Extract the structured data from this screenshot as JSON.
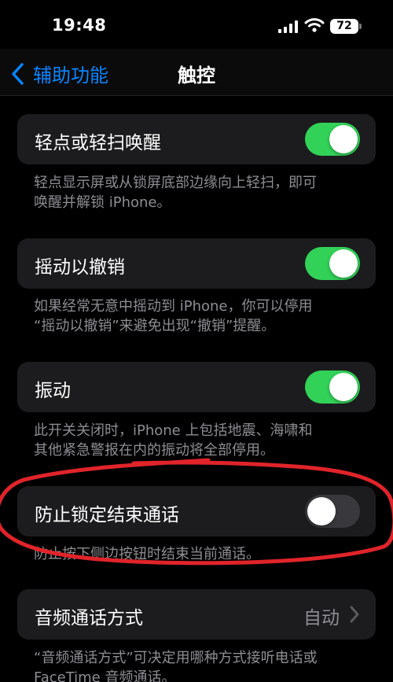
{
  "status": {
    "time": "19:48",
    "battery": "72",
    "icons": [
      "cellular-signal-icon",
      "wifi-icon",
      "battery-icon"
    ]
  },
  "nav": {
    "back_label": "辅助功能",
    "title": "触控"
  },
  "colors": {
    "accent": "#0a84ff",
    "toggle_on": "#32d158",
    "toggle_off": "#39393d",
    "annotation": "#e0242a"
  },
  "settings": [
    {
      "label": "轻点或轻扫唤醒",
      "toggle": true,
      "footer": [
        "轻点显示屏或从锁屏底部边缘向上轻扫，即可",
        "唤醒并解锁 iPhone。"
      ]
    },
    {
      "label": "摇动以撤销",
      "toggle": true,
      "footer": [
        "如果经常无意中摇动到 iPhone，你可以停用",
        "“摇动以撤销”来避免出现“撤销”提醒。"
      ]
    },
    {
      "label": "振动",
      "toggle": true,
      "footer": [
        "此开关关闭时，iPhone 上包括地震、海啸和",
        "其他紧急警报在内的振动将全部停用。"
      ]
    },
    {
      "label": "防止锁定结束通话",
      "toggle": false,
      "footer": [
        "防止按下侧边按钮时结束当前通话。"
      ]
    },
    {
      "label": "音频通话方式",
      "value": "自动",
      "footer": [
        "“音频通话方式”可决定用哪种方式接听电话或",
        "FaceTime 音频通话。"
      ]
    }
  ]
}
